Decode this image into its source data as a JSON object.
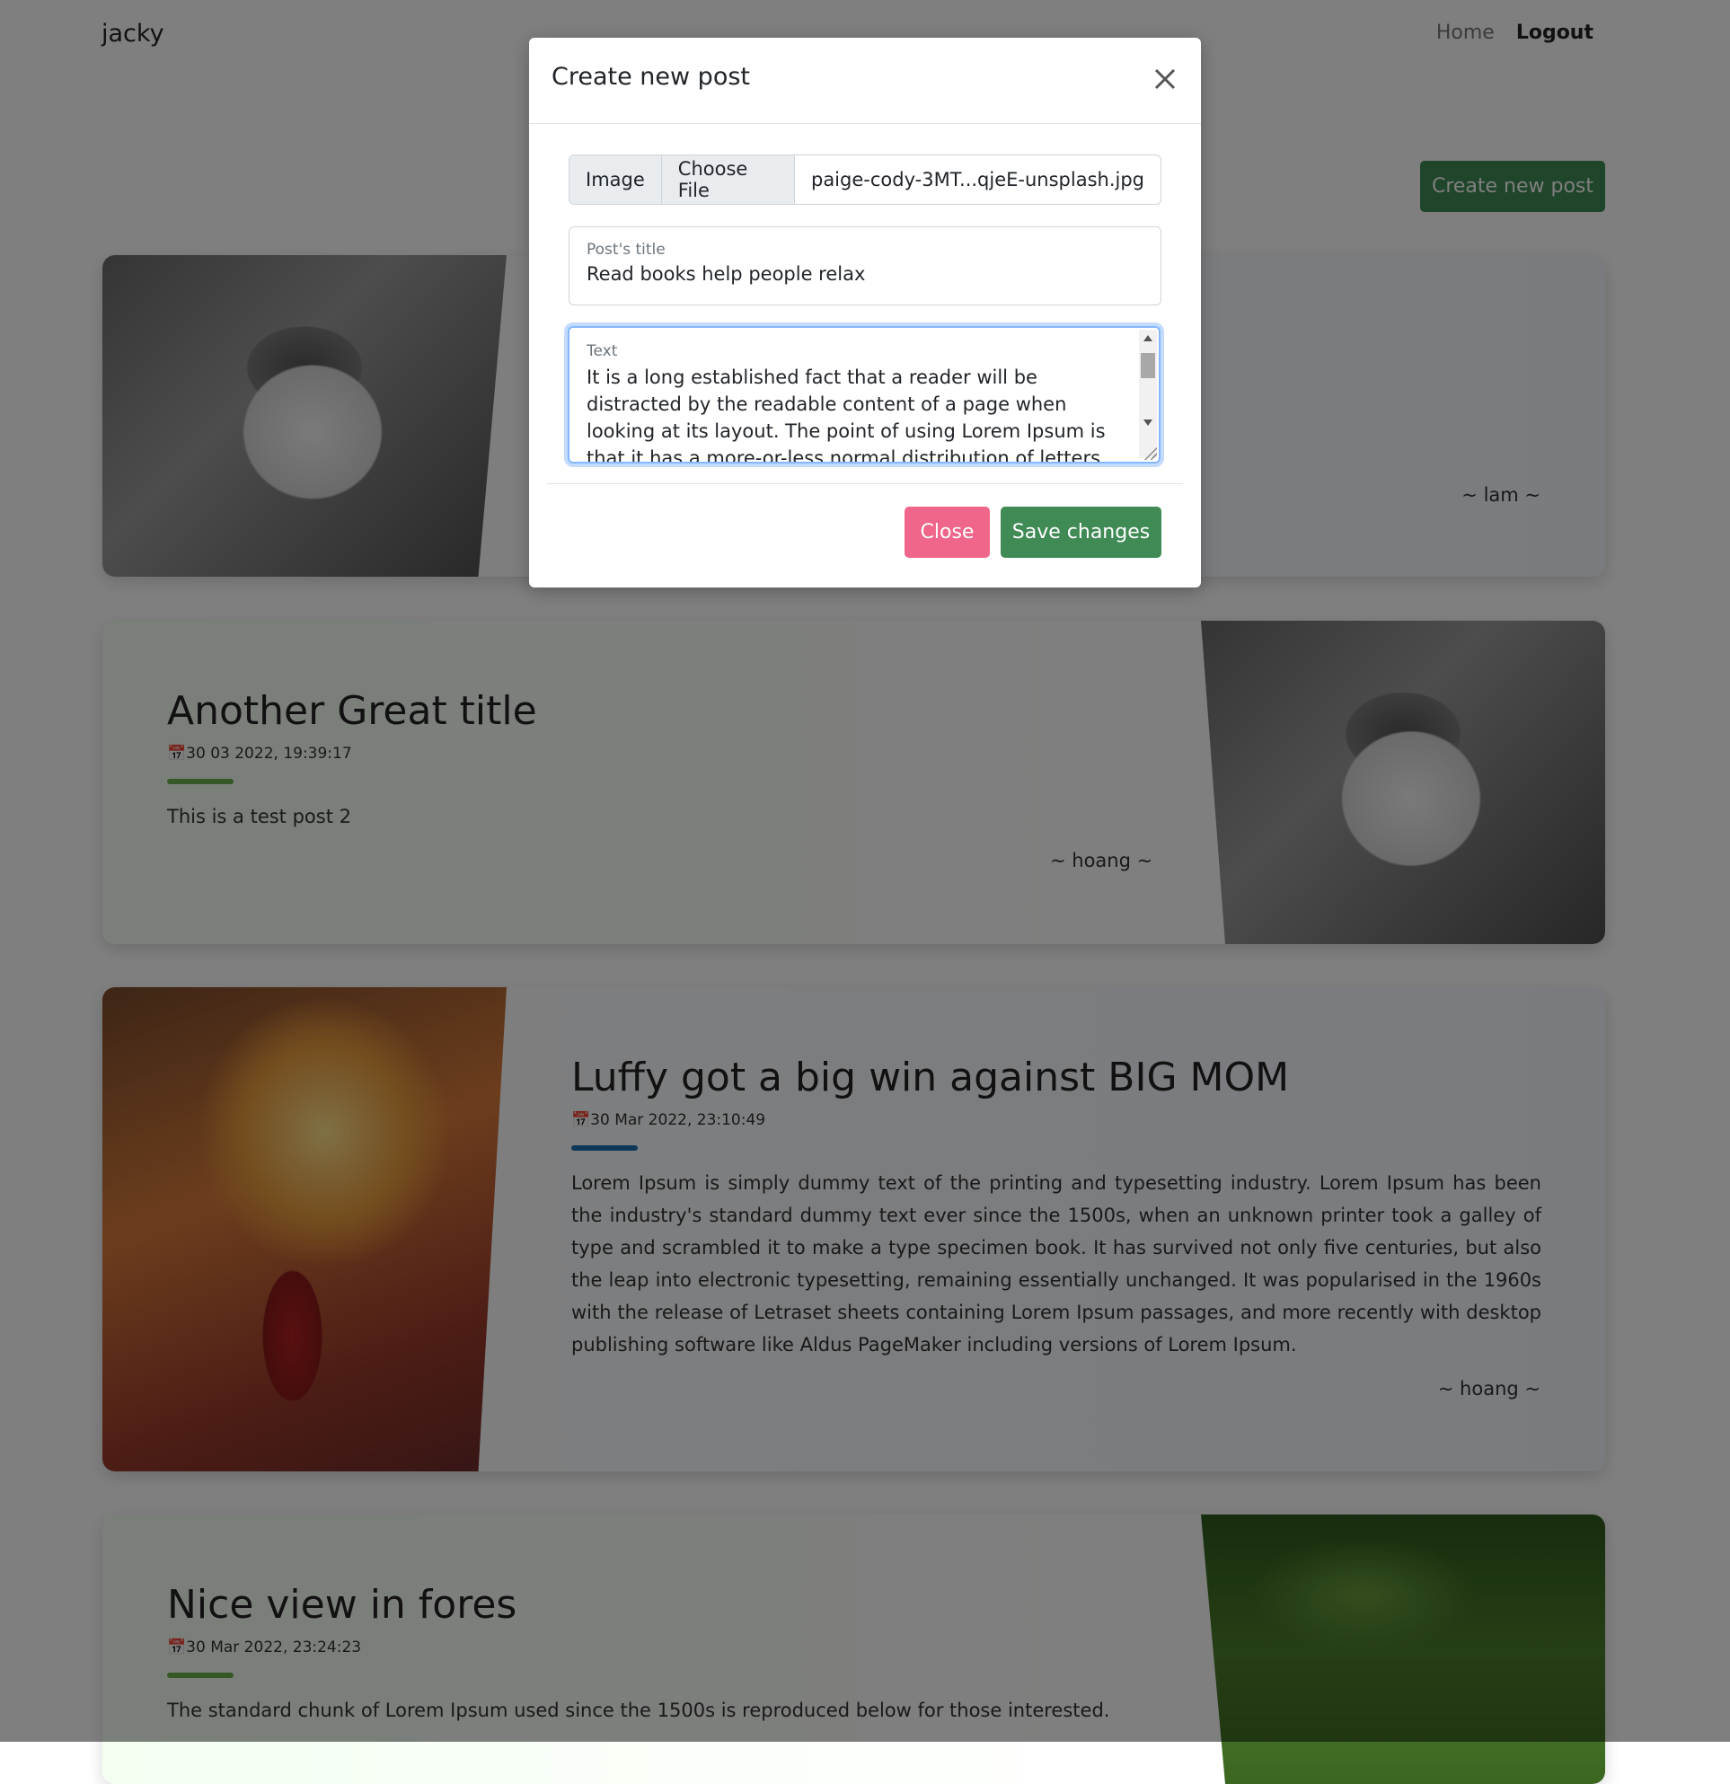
{
  "navbar": {
    "brand": "jacky",
    "links": [
      "Home",
      "Logout"
    ]
  },
  "create_button": "Create new post",
  "posts": [
    {
      "title": "",
      "date": "",
      "text": "",
      "author": "~ lam ~",
      "image": "cat-photo",
      "rule_color": "#6ab04c"
    },
    {
      "title": "Another Great title",
      "date": "30 03 2022, 19:39:17",
      "text": "This is a test post 2",
      "author": "~ hoang ~",
      "image": "cat-photo",
      "rule_color": "#6ab04c"
    },
    {
      "title": "Luffy got a big win against BIG MOM",
      "date": "30 Mar 2022, 23:10:49",
      "text": "Lorem Ipsum is simply dummy text of the printing and typesetting industry. Lorem Ipsum has been the industry's standard dummy text ever since the 1500s, when an unknown printer took a galley of type and scrambled it to make a type specimen book. It has survived not only five centuries, but also the leap into electronic typesetting, remaining essentially unchanged. It was popularised in the 1960s with the release of Letraset sheets containing Lorem Ipsum passages, and more recently with desktop publishing software like Aldus PageMaker including versions of Lorem Ipsum.",
      "author": "~ hoang ~",
      "image": "anime-art",
      "rule_color": "#1e6fb0"
    },
    {
      "title": "Nice view in fores",
      "date": "30 Mar 2022, 23:24:23",
      "text": "The standard chunk of Lorem Ipsum used since the 1500s is reproduced below for those interested.",
      "author": "",
      "image": "forest-photo",
      "rule_color": "#6ab04c"
    }
  ],
  "modal": {
    "title": "Create new post",
    "close_icon": "close-icon",
    "file": {
      "label": "Image",
      "button": "Choose File",
      "filename": "paige-cody-3MT...qjeE-unsplash.jpg"
    },
    "title_field": {
      "label": "Post's title",
      "value": "Read books help people relax"
    },
    "text_field": {
      "label": "Text",
      "value": "It is a long established fact that a reader will be distracted by the readable content of a page when looking at its layout. The point of using Lorem Ipsum is that it has a more-or-less normal distribution of letters, as opposed to"
    },
    "close_button": "Close",
    "save_button": "Save changes"
  },
  "colors": {
    "primary_green": "#3f8a55",
    "close_pink": "#f0658a",
    "focus_blue": "#86b7fe"
  }
}
